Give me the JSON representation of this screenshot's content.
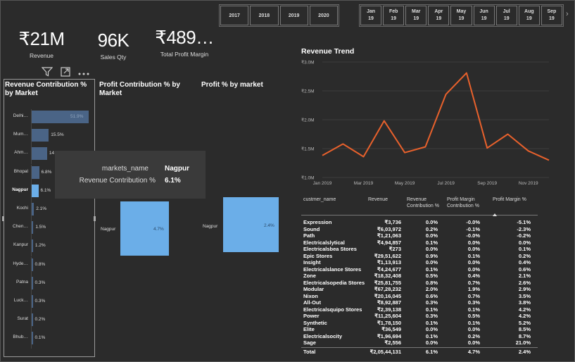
{
  "years": [
    "2017",
    "2018",
    "2019",
    "2020"
  ],
  "months": [
    {
      "m": "Jan",
      "y": "19"
    },
    {
      "m": "Feb",
      "y": "19"
    },
    {
      "m": "Mar",
      "y": "19"
    },
    {
      "m": "Apr",
      "y": "19"
    },
    {
      "m": "May",
      "y": "19"
    },
    {
      "m": "Jun",
      "y": "19"
    },
    {
      "m": "Jul",
      "y": "19"
    },
    {
      "m": "Aug",
      "y": "19"
    },
    {
      "m": "Sep",
      "y": "19"
    }
  ],
  "month_next": "›",
  "kpis": {
    "revenue": {
      "value": "₹21M",
      "label": "Revenue"
    },
    "sales_qty": {
      "value": "96K",
      "label": "Sales Qty"
    },
    "profit_margin": {
      "value": "₹489…",
      "label": "Total Profit Margin"
    }
  },
  "toolbar": {
    "filter_icon": "filter-icon",
    "focus_icon": "focus-mode-icon",
    "more_icon": "more-options-icon"
  },
  "revenue_contribution": {
    "title": "Revenue Contribution % by Market",
    "bars": [
      {
        "market": "Delhi…",
        "pct": 51.9,
        "label": "51.9%",
        "selected": false
      },
      {
        "market": "Mum…",
        "pct": 15.5,
        "label": "15.5%",
        "selected": false
      },
      {
        "market": "Ahm…",
        "pct": 14.0,
        "label": "14",
        "selected": false
      },
      {
        "market": "Bhopal",
        "pct": 6.8,
        "label": "6.8%",
        "selected": false
      },
      {
        "market": "Nagpur",
        "pct": 6.1,
        "label": "6.1%",
        "selected": true
      },
      {
        "market": "Kochi",
        "pct": 2.1,
        "label": "2.1%",
        "selected": false
      },
      {
        "market": "Chen…",
        "pct": 1.5,
        "label": "1.5%",
        "selected": false
      },
      {
        "market": "Kanpur",
        "pct": 1.2,
        "label": "1.2%",
        "selected": false
      },
      {
        "market": "Hyde…",
        "pct": 0.8,
        "label": "0.8%",
        "selected": false
      },
      {
        "market": "Patna",
        "pct": 0.3,
        "label": "0.3%",
        "selected": false
      },
      {
        "market": "Luck…",
        "pct": 0.3,
        "label": "0.3%",
        "selected": false
      },
      {
        "market": "Surat",
        "pct": 0.2,
        "label": "0.2%",
        "selected": false
      },
      {
        "market": "Bhub…",
        "pct": 0.1,
        "label": "0.1%",
        "selected": false
      }
    ]
  },
  "tooltip": {
    "row1_label": "markets_name",
    "row1_value": "Nagpur",
    "row2_label": "Revenue Contribution %",
    "row2_value": "6.1%"
  },
  "profit_contribution": {
    "title": "Profit Contribution % by Market",
    "market": "Nagpur",
    "value_label": "4.7%"
  },
  "profit_pct": {
    "title": "Profit % by market",
    "market": "Nagpur",
    "value_label": "2.4%"
  },
  "chart_data": {
    "type": "line",
    "title": "Revenue Trend",
    "x": [
      "Jan 2019",
      "Feb 2019",
      "Mar 2019",
      "Apr 2019",
      "May 2019",
      "Jun 2019",
      "Jul 2019",
      "Aug 2019",
      "Sep 2019",
      "Oct 2019",
      "Nov 2019",
      "Dec 2019"
    ],
    "x_tick_labels": [
      "Jan 2019",
      "Mar 2019",
      "May 2019",
      "Jul 2019",
      "Sep 2019",
      "Nov 2019"
    ],
    "values": [
      1.38,
      1.58,
      1.36,
      1.98,
      1.43,
      1.53,
      2.44,
      2.81,
      1.51,
      1.75,
      1.46,
      1.3
    ],
    "y_unit": "M",
    "ylim": [
      1.0,
      3.0
    ],
    "y_ticks": [
      "₹1.0M",
      "₹1.5M",
      "₹2.0M",
      "₹2.5M",
      "₹3.0M"
    ],
    "color": "#e8612c",
    "grid": true
  },
  "table": {
    "headers": [
      "custmer_name",
      "Revenue",
      "Revenue Contribution %",
      "Profit Margin Contribution %",
      "Profit Margin %"
    ],
    "rows": [
      [
        "Expression",
        "₹3,736",
        "0.0%",
        "-0.0%",
        "-5.1%"
      ],
      [
        "Sound",
        "₹6,03,972",
        "0.2%",
        "-0.1%",
        "-2.3%"
      ],
      [
        "Path",
        "₹1,21,063",
        "0.0%",
        "-0.0%",
        "-0.2%"
      ],
      [
        "Electricalslytical",
        "₹4,94,857",
        "0.1%",
        "0.0%",
        "0.0%"
      ],
      [
        "Electricalsbea Stores",
        "₹273",
        "0.0%",
        "0.0%",
        "0.1%"
      ],
      [
        "Epic Stores",
        "₹29,51,622",
        "0.9%",
        "0.1%",
        "0.2%"
      ],
      [
        "Insight",
        "₹1,13,913",
        "0.0%",
        "0.0%",
        "0.4%"
      ],
      [
        "Electricalslance Stores",
        "₹4,24,677",
        "0.1%",
        "0.0%",
        "0.6%"
      ],
      [
        "Zone",
        "₹18,32,408",
        "0.5%",
        "0.4%",
        "2.1%"
      ],
      [
        "Electricalsopedia Stores",
        "₹25,81,755",
        "0.8%",
        "0.7%",
        "2.6%"
      ],
      [
        "Modular",
        "₹67,28,232",
        "2.0%",
        "1.9%",
        "2.9%"
      ],
      [
        "Nixon",
        "₹20,16,045",
        "0.6%",
        "0.7%",
        "3.5%"
      ],
      [
        "All-Out",
        "₹8,92,887",
        "0.3%",
        "0.3%",
        "3.8%"
      ],
      [
        "Electricalsquipo Stores",
        "₹2,39,138",
        "0.1%",
        "0.1%",
        "4.2%"
      ],
      [
        "Power",
        "₹11,25,604",
        "0.3%",
        "0.5%",
        "4.2%"
      ],
      [
        "Synthetic",
        "₹1,78,150",
        "0.1%",
        "0.1%",
        "5.2%"
      ],
      [
        "Elite",
        "₹36,549",
        "0.0%",
        "0.0%",
        "8.5%"
      ],
      [
        "Electricalsocity",
        "₹1,96,694",
        "0.1%",
        "0.2%",
        "8.7%"
      ],
      [
        "Sage",
        "₹2,556",
        "0.0%",
        "0.0%",
        "21.0%"
      ]
    ],
    "total": [
      "Total",
      "₹2,05,44,131",
      "6.1%",
      "4.7%",
      "2.4%"
    ]
  }
}
